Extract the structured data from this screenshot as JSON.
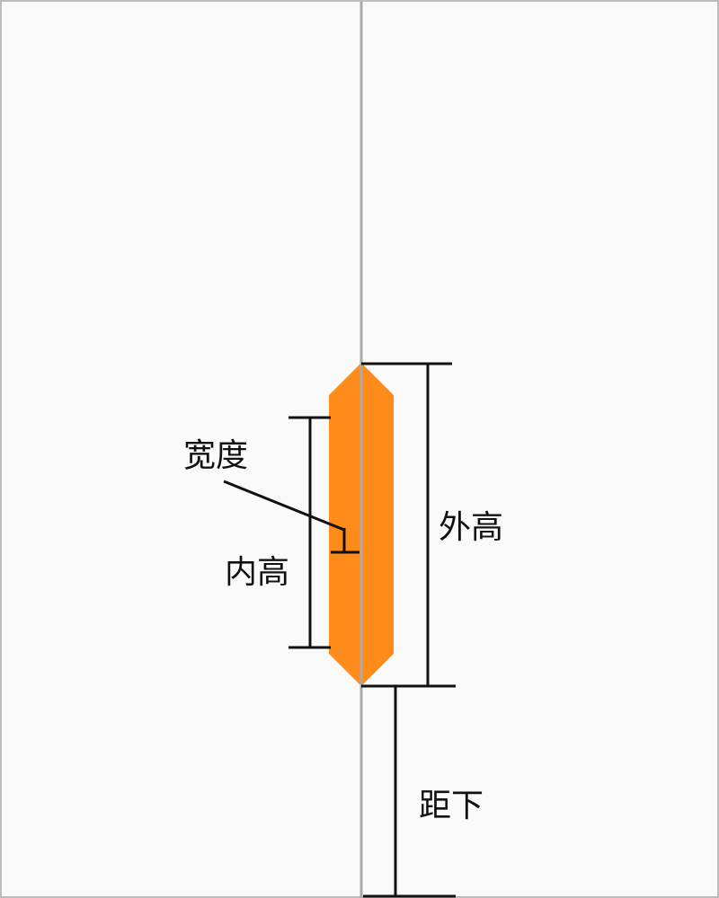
{
  "diagram": {
    "labels": {
      "width": "宽度",
      "inner_height": "内高",
      "outer_height": "外高",
      "distance_below": "距下"
    },
    "colors": {
      "background": "#fafafa",
      "border": "#bdbdbd",
      "axis_line": "#aaaaaa",
      "shape_fill": "#ff8c1a",
      "dimension_lines": "#111111"
    }
  }
}
